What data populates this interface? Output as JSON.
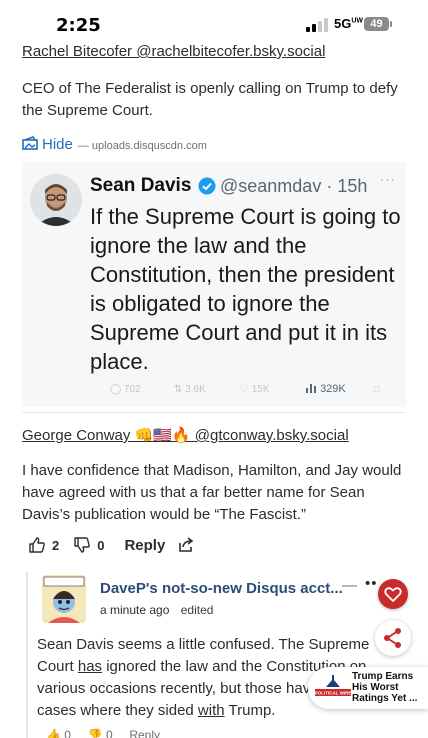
{
  "status_bar": {
    "time": "2:25",
    "network": "5G",
    "network_suffix": "UW",
    "battery": "49"
  },
  "top_comment": {
    "author": "Rachel Bitecofer @rachelbitecofer.bsky.social",
    "text": "CEO of The Federalist is openly calling on Trump to defy the Supreme Court."
  },
  "embed": {
    "hide_label": "Hide",
    "source": "— uploads.disquscdn.com"
  },
  "tweet": {
    "name": "Sean Davis",
    "handle": "@seanmdav · 15h",
    "more": "···",
    "text": "If the Supreme Court is going to ignore the law and the Constitution, then the president is obligated to ignore the Supreme Court and put it in its place.",
    "replies": "702",
    "reposts": "3.6K",
    "likes": "15K",
    "views": "329K"
  },
  "comment2": {
    "author": "George Conway 👊🇺🇸🔥 @gtconway.bsky.social",
    "text": "I have confidence that Madison, Hamilton, and Jay would have agreed with us that a far better name for Sean Davis’s publication would be “The Fascist.”",
    "upvotes": "2",
    "downvotes": "0",
    "reply_label": "Reply"
  },
  "reply": {
    "author": "DaveP's not-so-new Disqus acct...",
    "collapse": "—",
    "dots": "••",
    "time": "a minute ago",
    "edited": "edited",
    "text_1": "Sean Davis seems a little confused. The Supreme Court ",
    "text_2": "has",
    "text_3": " ignored the law and the Constitution on various occasions recently, but those have been cases where they sided ",
    "text_4": "with",
    "text_5": " Trump.",
    "upvotes": "0",
    "downvotes": "0",
    "reply_label": "Reply"
  },
  "news_toast": {
    "logo_text": "POLITICAL WIRE",
    "headline": "Trump Earns His Worst Ratings Yet ..."
  },
  "colors": {
    "link_blue": "#1d6fbf",
    "author_blue": "#2c4d7a",
    "heart_red": "#c92a2a"
  }
}
